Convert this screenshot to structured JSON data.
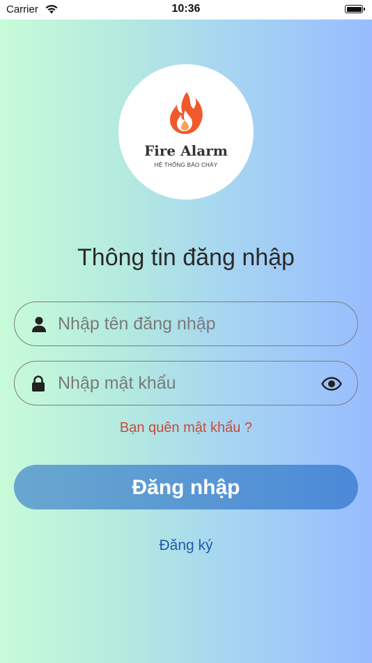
{
  "status_bar": {
    "carrier": "Carrier",
    "time": "10:36"
  },
  "logo": {
    "title": "Fire Alarm",
    "subtitle": "HỆ THỐNG BÁO CHÁY"
  },
  "page_title": "Thông tin đăng nhập",
  "username_field": {
    "value": "",
    "placeholder": "Nhập tên đăng nhập"
  },
  "password_field": {
    "value": "",
    "placeholder": "Nhập mật khẩu"
  },
  "forgot_password_label": "Bạn quên mật khẩu ?",
  "login_button_label": "Đăng nhập",
  "register_link_label": "Đăng ký",
  "icons": {
    "wifi": "wifi-icon",
    "battery": "battery-icon",
    "flame": "flame-icon",
    "user": "user-icon",
    "lock": "lock-icon",
    "eye": "eye-icon"
  },
  "colors": {
    "forgot_text": "#c84a3d",
    "register_text": "#1f5aa8",
    "button_start": "#69a7cf",
    "button_end": "#4b89d9",
    "flame": "#f0592b"
  }
}
